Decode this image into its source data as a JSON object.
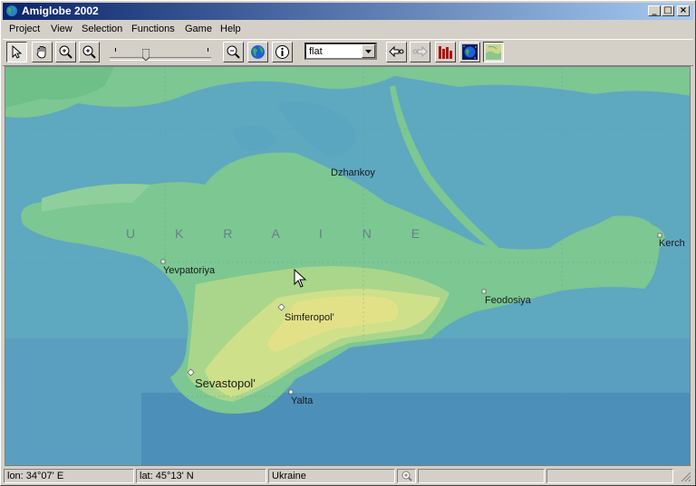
{
  "window": {
    "title": "Amiglobe 2002"
  },
  "menu": [
    "Project",
    "View",
    "Selection",
    "Functions",
    "Game",
    "Help"
  ],
  "toolbar": {
    "buttons": [
      "select-arrow-icon",
      "pan-hand-icon",
      "zoom-in-plus-icon",
      "zoom-magnify-icon",
      "zoom-out-icon",
      "globe-icon",
      "info-icon",
      "back-arrow-icon",
      "forward-arrow-icon",
      "bar-chart-icon",
      "night-globe-icon",
      "relief-map-icon"
    ],
    "projection": {
      "selected": "flat"
    }
  },
  "map": {
    "region_label": "U K R A I N E",
    "cities": [
      {
        "name": "Dzhankoy"
      },
      {
        "name": "Kerch"
      },
      {
        "name": "Yevpatoriya"
      },
      {
        "name": "Feodosiya"
      },
      {
        "name": "Simferopol'"
      },
      {
        "name": "Sevastopol'"
      },
      {
        "name": "Yalta"
      }
    ],
    "colors": {
      "sea_shallow": "#5ea8c0",
      "sea_deep": "#4c8fb8",
      "lowland": "#7cc792",
      "upland": "#cfe08a",
      "mountain": "#e3e188"
    }
  },
  "status": {
    "lon": "lon: 34°07' E",
    "lat": "lat: 45°13' N",
    "country": "Ukraine"
  }
}
